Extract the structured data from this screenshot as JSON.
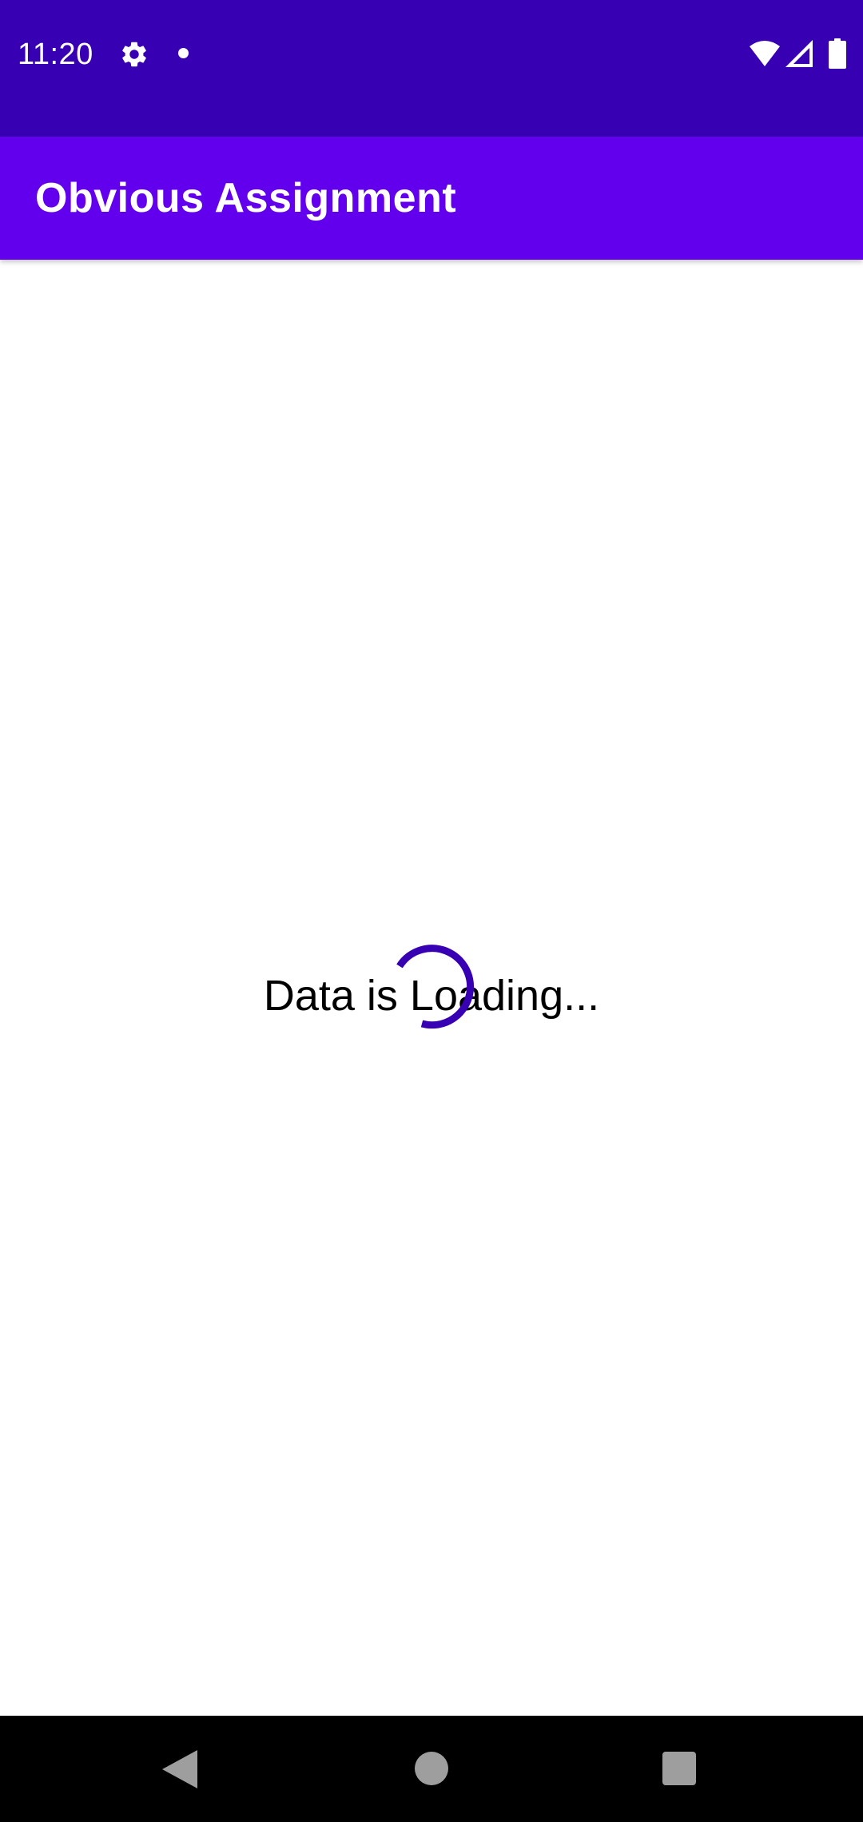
{
  "status_bar": {
    "time": "11:20",
    "icons": [
      "gear-icon",
      "notification-dot-icon",
      "wifi-icon",
      "signal-icon",
      "battery-icon"
    ],
    "background_color": "#3700b3"
  },
  "app_bar": {
    "title": "Obvious Assignment",
    "background_color": "#6200ee"
  },
  "main": {
    "loading_text": "Data is Loading...",
    "spinner_color": "#3700b3"
  },
  "nav_bar": {
    "buttons": [
      "back-icon",
      "home-icon",
      "recents-icon"
    ]
  }
}
